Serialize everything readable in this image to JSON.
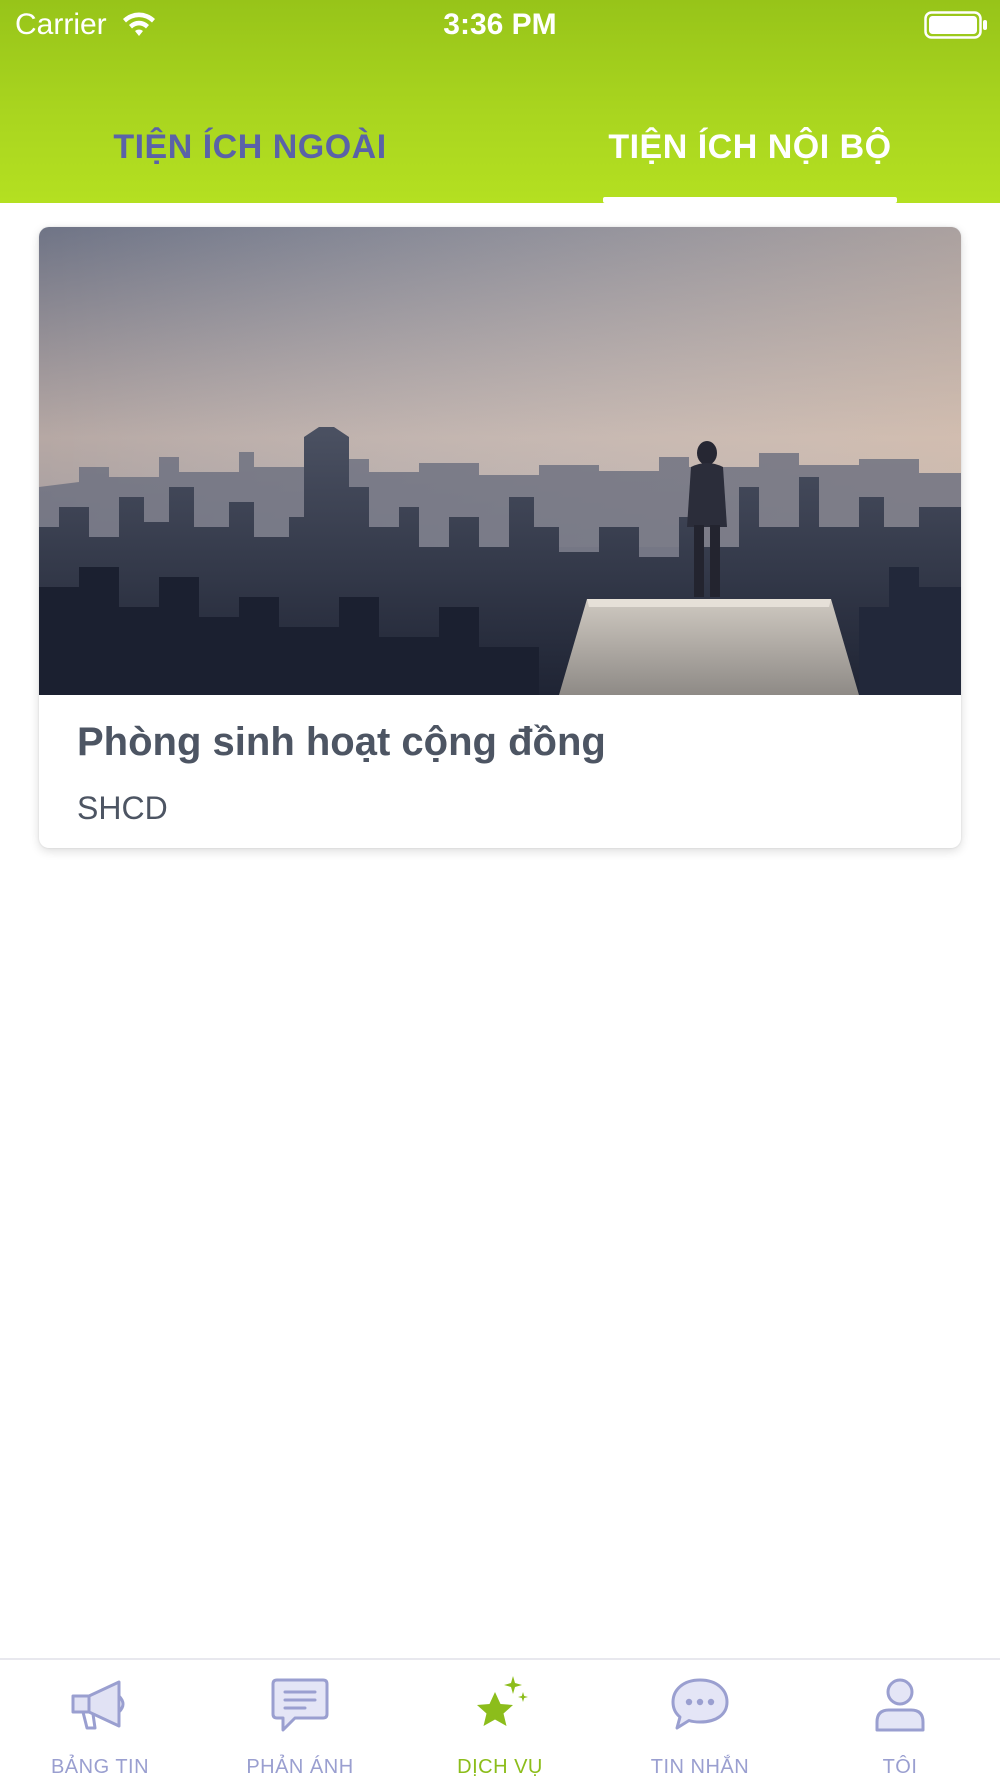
{
  "status_bar": {
    "carrier": "Carrier",
    "time": "3:36 PM"
  },
  "tabs": [
    {
      "label": "TIỆN ÍCH NGOÀI",
      "active": false
    },
    {
      "label": "TIỆN ÍCH NỘI BỘ",
      "active": true
    }
  ],
  "card": {
    "title": "Phòng sinh hoạt cộng đồng",
    "subtitle": "SHCD"
  },
  "bottom_nav": [
    {
      "label": "BẢNG TIN",
      "icon": "megaphone-icon",
      "active": false
    },
    {
      "label": "PHẢN ÁNH",
      "icon": "feedback-icon",
      "active": false
    },
    {
      "label": "DỊCH VỤ",
      "icon": "star-icon",
      "active": true
    },
    {
      "label": "TIN NHẮN",
      "icon": "chat-bubble-icon",
      "active": false
    },
    {
      "label": "TÔI",
      "icon": "user-icon",
      "active": false
    }
  ],
  "colors": {
    "header_green": "#a9d51f",
    "tab_inactive": "#5a62a8",
    "nav_inactive": "#9a9fd0",
    "nav_active": "#8cbd1b",
    "card_text": "#4d5563"
  }
}
